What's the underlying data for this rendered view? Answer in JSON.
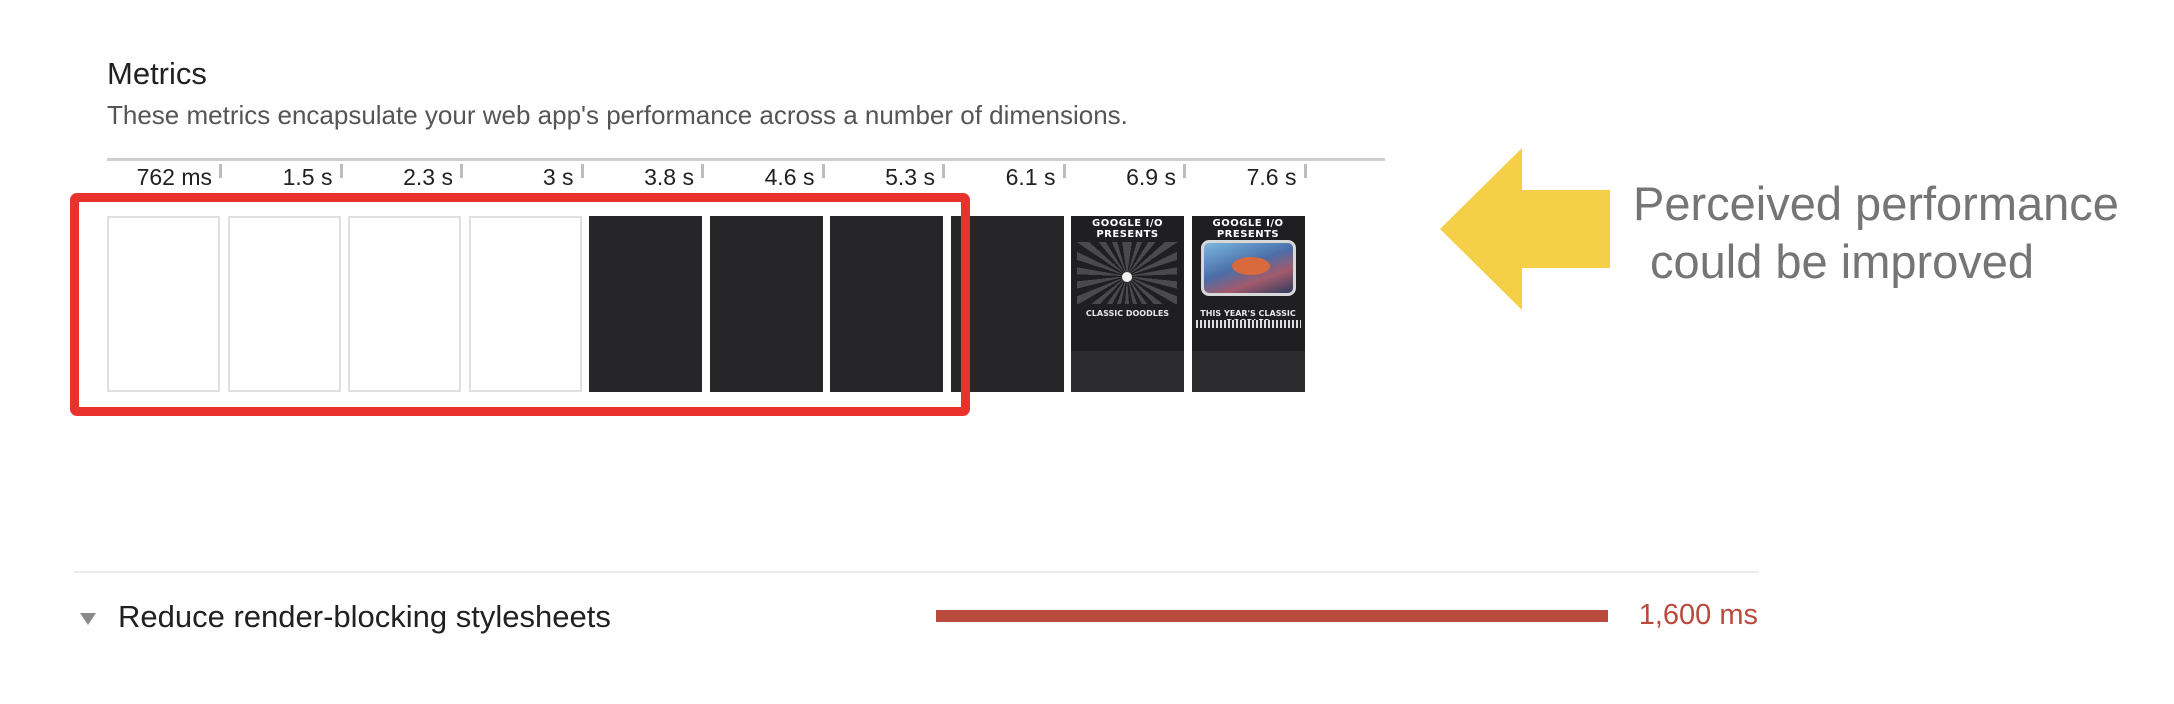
{
  "metrics": {
    "title": "Metrics",
    "description": "These metrics encapsulate your web app's performance across a number of dimensions."
  },
  "filmstrip": {
    "ticks": [
      "762 ms",
      "1.5 s",
      "2.3 s",
      "3 s",
      "3.8 s",
      "4.6 s",
      "5.3 s",
      "6.1 s",
      "6.9 s",
      "7.6 s"
    ],
    "frames": [
      "blank",
      "blank",
      "blank",
      "blank",
      "dark",
      "dark",
      "dark",
      "dark",
      "splash",
      "content"
    ],
    "screenshot": {
      "title": "GOOGLE I/O PRESENTS",
      "splash_subtitle": "CLASSIC DOODLES",
      "content_subtitle": "THIS YEAR'S CLASSIC DOODLES"
    }
  },
  "callout": {
    "line1": "Perceived performance",
    "line2": "could be improved",
    "arrow_color": "#f5cf47",
    "highlight_color": "#e8322b"
  },
  "audit": {
    "title": "Reduce render-blocking stylesheets",
    "value": "1,600 ms",
    "bar_fraction": 1.0,
    "bar_color": "#b94a3c"
  }
}
